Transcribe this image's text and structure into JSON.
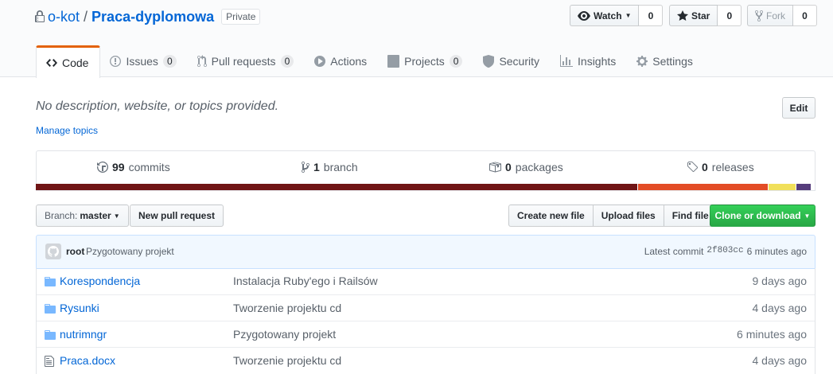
{
  "repo": {
    "owner": "o-kot",
    "separator": "/",
    "name": "Praca-dyplomowa",
    "visibility": "Private"
  },
  "actions": {
    "watch_label": "Watch",
    "watch_count": "0",
    "star_label": "Star",
    "star_count": "0",
    "fork_label": "Fork",
    "fork_count": "0"
  },
  "tabs": [
    {
      "label": "Code",
      "icon": "code-icon",
      "selected": true
    },
    {
      "label": "Issues",
      "icon": "issue-icon",
      "counter": "0"
    },
    {
      "label": "Pull requests",
      "icon": "pull-request-icon",
      "counter": "0"
    },
    {
      "label": "Actions",
      "icon": "play-icon"
    },
    {
      "label": "Projects",
      "icon": "project-icon",
      "counter": "0"
    },
    {
      "label": "Security",
      "icon": "shield-icon"
    },
    {
      "label": "Insights",
      "icon": "graph-icon"
    },
    {
      "label": "Settings",
      "icon": "gear-icon"
    }
  ],
  "description": "No description, website, or topics provided.",
  "manage_topics": "Manage topics",
  "edit_label": "Edit",
  "summary": {
    "commits_count": "99",
    "commits_label": "commits",
    "branch_count": "1",
    "branch_label": "branch",
    "packages_count": "0",
    "packages_label": "packages",
    "releases_count": "0",
    "releases_label": "releases"
  },
  "language_bar": [
    {
      "color": "#701516",
      "share": 0.775
    },
    {
      "color": "#e34c26",
      "share": 0.167
    },
    {
      "color": "#f1e05a",
      "share": 0.034
    },
    {
      "color": "#563d7c",
      "share": 0.019
    }
  ],
  "branch_select": {
    "prefix": "Branch:",
    "value": "master"
  },
  "new_pr_label": "New pull request",
  "file_nav": {
    "create": "Create new file",
    "upload": "Upload files",
    "find": "Find file"
  },
  "clone_label": "Clone or download",
  "commit": {
    "author": "root",
    "message": "Pzygotowany projekt",
    "latest_label": "Latest commit",
    "sha": "2f803cc",
    "age": "6 minutes ago"
  },
  "files": [
    {
      "type": "dir",
      "name": "Korespondencja",
      "message": "Instalacja Ruby'ego i Railsów",
      "age": "9 days ago"
    },
    {
      "type": "dir",
      "name": "Rysunki",
      "message": "Tworzenie projektu cd",
      "age": "4 days ago"
    },
    {
      "type": "dir",
      "name": "nutrimngr",
      "message": "Pzygotowany projekt",
      "age": "6 minutes ago"
    },
    {
      "type": "file",
      "name": "Praca.docx",
      "message": "Tworzenie projektu cd",
      "age": "4 days ago"
    }
  ],
  "colors": {
    "link": "#0366d6",
    "tab_accent": "#e36209",
    "clone_green": "#28a745"
  }
}
